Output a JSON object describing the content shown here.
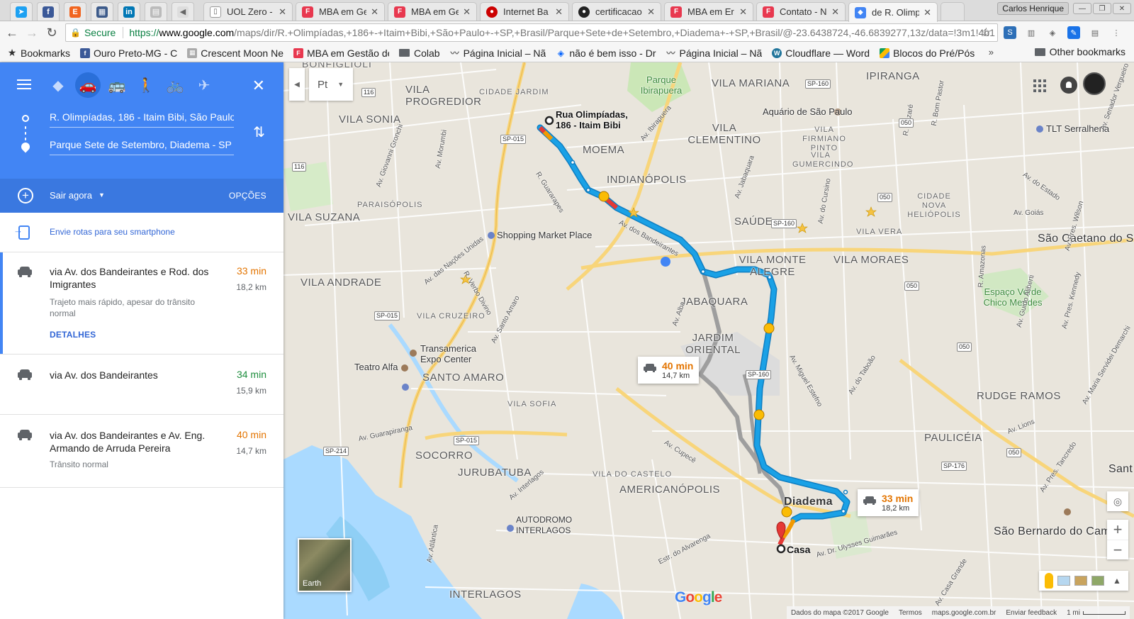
{
  "browser": {
    "tabs": [
      {
        "title": "UOL Zero -",
        "favicon_color": "#ffffff"
      },
      {
        "title": "MBA em Ge",
        "favicon_color": "#e8384f"
      },
      {
        "title": "MBA em Ge",
        "favicon_color": "#e8384f"
      },
      {
        "title": "Internet Ba",
        "favicon_color": "#cc0000"
      },
      {
        "title": "certificacao",
        "favicon_color": "#222222"
      },
      {
        "title": "MBA em Er",
        "favicon_color": "#e8384f"
      },
      {
        "title": "Contato - N",
        "favicon_color": "#e8384f"
      },
      {
        "title": "de R. Olimp",
        "favicon_color": "#4285f4"
      }
    ],
    "pinned_icons": [
      "twitter-alt-icon",
      "facebook-icon",
      "etsy-icon",
      "archive-icon",
      "linkedin-icon",
      "grid-icon",
      "speaker-icon"
    ],
    "profile_name": "Carlos Henrique",
    "secure_label": "Secure",
    "url": {
      "scheme": "https://",
      "host": "www.google.com",
      "path": "/maps/dir/R.+Olimpíadas,+186+-+Itaim+Bibi,+São+Paulo+-+SP,+Brasil/Parque+Sete+de+Setembro,+Diadema+-+SP,+Brasil/@-23.6438724,-46.6839277,13z/data=!3m1!4b1"
    },
    "bookmarks": [
      {
        "label": "Bookmarks",
        "icon": "star-icon",
        "color": "#333333"
      },
      {
        "label": "Ouro Preto-MG - C",
        "icon": "facebook-icon",
        "color": "#3b5998"
      },
      {
        "label": "Crescent Moon Ne",
        "icon": "grid-icon",
        "color": "#999999"
      },
      {
        "label": "MBA em Gestão de",
        "icon": "mba-icon",
        "color": "#e8384f"
      },
      {
        "label": "Colab",
        "icon": "folder-icon",
        "color": "#5f6368"
      },
      {
        "label": "Página Inicial – Nã",
        "icon": "wave-icon",
        "color": "#666666"
      },
      {
        "label": "não é bem isso - Dr",
        "icon": "dropbox-icon",
        "color": "#0061fe"
      },
      {
        "label": "Página Inicial – Nã",
        "icon": "wave-icon",
        "color": "#666666"
      },
      {
        "label": "Cloudflare — Word",
        "icon": "wordpress-icon",
        "color": "#21759b"
      },
      {
        "label": "Blocos do Pré/Pós",
        "icon": "drive-icon",
        "color": "#0f9d58"
      }
    ],
    "bookmarks_more": "»",
    "other_bookmarks": "Other bookmarks"
  },
  "directions": {
    "travel_modes": [
      "best-route-icon",
      "car-icon",
      "transit-icon",
      "walk-icon",
      "bike-icon",
      "flight-icon"
    ],
    "active_mode": "car-icon",
    "origin": "R. Olimpíadas, 186 - Itaim Bibi, São Paulo",
    "destination": "Parque Sete de Setembro, Diadema - SP",
    "depart_label": "Sair agora",
    "options_label": "OPÇÕES",
    "send_to_phone": "Envie rotas para seu smartphone",
    "routes": [
      {
        "title": "via Av. dos Bandeirantes e Rod. dos Imigrantes",
        "time": "33 min",
        "time_color": "orange",
        "distance": "18,2 km",
        "note": "Trajeto mais rápido, apesar do trânsito normal",
        "details": "DETALHES"
      },
      {
        "title": "via Av. dos Bandeirantes",
        "time": "34 min",
        "time_color": "green",
        "distance": "15,9 km",
        "note": "",
        "details": ""
      },
      {
        "title": "via Av. dos Bandeirantes e Av. Eng. Armando de Arruda Pereira",
        "time": "40 min",
        "time_color": "orange",
        "distance": "14,7 km",
        "note": "Trânsito normal",
        "details": ""
      }
    ]
  },
  "map": {
    "language_selector": "Pt",
    "origin_label": "Rua Olimpíadas, 186 - Itaim Bibi",
    "destination_label": "Casa",
    "alt_route_card": {
      "time": "40 min",
      "distance": "14,7 km"
    },
    "main_route_card": {
      "time": "33 min",
      "distance": "18,2 km"
    },
    "earth_label": "Earth",
    "google_logo": "Google",
    "footer": {
      "map_data": "Dados do mapa ©2017 Google",
      "terms": "Termos",
      "domain": "maps.google.com.br",
      "feedback": "Enviar feedback",
      "scale": "1 mi"
    },
    "colors": {
      "route_primary": "#1aa1e6",
      "route_alt": "#9e9e9e",
      "traffic_orange": "#f29900",
      "traffic_red": "#e53935"
    },
    "neighborhoods": [
      "BONFIGLIOLI",
      "VILA PROGREDIOR",
      "VILA SONIA",
      "VILA SUZANA",
      "PARAISÓPOLIS",
      "VILA ANDRADE",
      "VILA CRUZEIRO",
      "SANTO AMARO",
      "VILA SOFIA",
      "SOCORRO",
      "JURUBATUBA",
      "INTERLAGOS",
      "CIDADE JARDIM",
      "MOEMA",
      "INDIANÓPOLIS",
      "VILA MARIANA",
      "VILA CLEMENTINO",
      "VILA FIRMIANO PINTO",
      "VILA GUMERCINDO",
      "SAÚDE",
      "VILA MONTE ALEGRE",
      "JABAQUARA",
      "JARDIM ORIENTAL",
      "VILA DO CASTELO",
      "AMERICANÓPOLIS",
      "IPIRANGA",
      "CIDADE NOVA HELIÓPOLIS",
      "VILA VERA",
      "VILA MORAES",
      "RUDGE RAMOS",
      "PAULICÉIA"
    ],
    "cities": [
      "São Caetano do Sul",
      "Diadema",
      "São Bernardo do Campo",
      "Sant"
    ],
    "pois": [
      "Shopping Market Place",
      "Aquário de São Paulo",
      "TLT Serralheria",
      "Transamerica Expo Center",
      "Teatro Alfa",
      "AUTODROMO INTERLAGOS"
    ],
    "parks": [
      "Parque Ibirapuera",
      "Espaço Verde Chico Mendes"
    ],
    "road_names": [
      "Av. dos Bandeirantes",
      "Av. Cupecê",
      "Av. Guarapiranga",
      "Av. Interlagos",
      "Av. Goiás",
      "Av. do Estado",
      "Av. Ibirapuera",
      "Av. Jabaquara",
      "Av. Santo Amaro",
      "Av. das Nações Unidas",
      "Av. Miguel Estefno",
      "Av. do Taboão",
      "Av. Lions",
      "Av. Alba",
      "Av. do Cursino",
      "Av. Atlântica",
      "Av. Dr. Ulysses Guimarães",
      "Estr. do Alvarenga",
      "R. Guararapes",
      "R. Verbo Divino",
      "Av. Giovanni Gronchi",
      "Av. Morumbi",
      "R. Bom Pastor",
      "R. Nazaré",
      "R. Amazonas",
      "Av. Guido Aliberti",
      "Av. Pres. Kennedy",
      "Av. Pres. Wilson",
      "Av. Senador Vergueiro",
      "Av. Maria Servidei Demarchi",
      "Av. Casa Grande",
      "Av. Pres. Tancredo"
    ],
    "shields": [
      "116",
      "116",
      "SP-015",
      "SP-015",
      "SP-015",
      "SP-160",
      "SP-160",
      "SP-160",
      "SP-214",
      "SP-176",
      "050",
      "050",
      "050",
      "050",
      "050"
    ]
  }
}
